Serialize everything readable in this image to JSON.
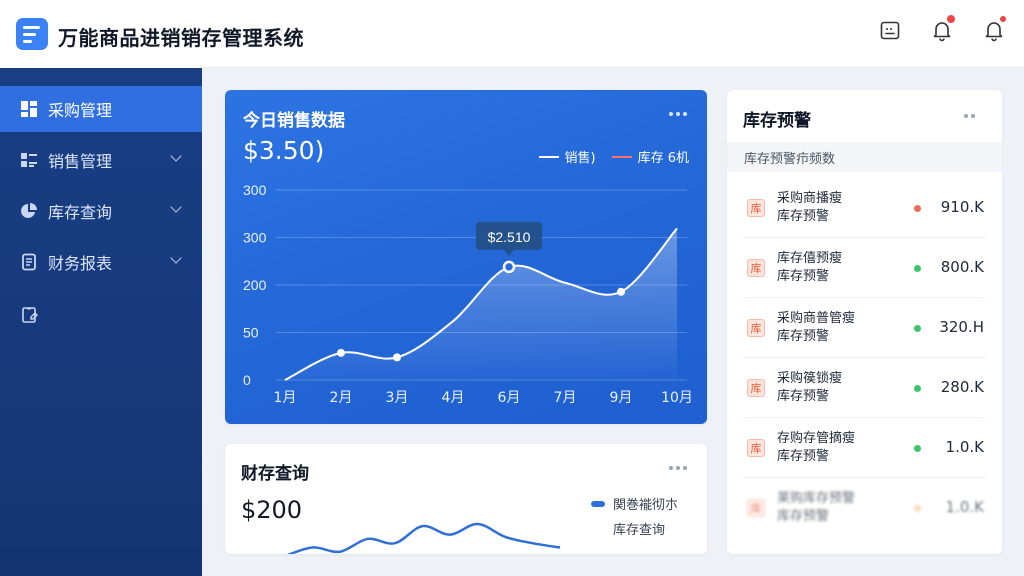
{
  "app": {
    "title": "万能商品进销销存管理系统"
  },
  "sidebar": {
    "items": [
      {
        "label": "采购管理",
        "icon": "grid-icon",
        "active": true,
        "has_children": false
      },
      {
        "label": "销售管理",
        "icon": "list-grid-icon",
        "active": false,
        "has_children": true
      },
      {
        "label": "库存查询",
        "icon": "pie-chart-icon",
        "active": false,
        "has_children": true
      },
      {
        "label": "财务报表",
        "icon": "document-icon",
        "active": false,
        "has_children": true
      }
    ],
    "extra_icon": "clipboard-icon"
  },
  "header": {
    "icons": [
      "calendar-icon",
      "notification-bell-icon",
      "bell-icon"
    ],
    "colors": {
      "notification_dot": "#ef4444"
    }
  },
  "sales_card": {
    "title": "今日销售数据",
    "amount": "$3.50)",
    "legend": [
      {
        "name": "销售)",
        "color": "#ffffff"
      },
      {
        "name": "库存 6机",
        "color": "#f87171"
      }
    ],
    "chart_data": {
      "type": "line",
      "x": [
        "1月",
        "2月",
        "3月",
        "4月",
        "6月",
        "7月",
        "9月",
        "10月"
      ],
      "y_ticks": [
        "0",
        "50",
        "200",
        "300",
        "300"
      ],
      "series": [
        {
          "name": "销售)",
          "values": [
            0,
            60,
            50,
            130,
            250,
            215,
            195,
            335
          ]
        }
      ],
      "tooltip": {
        "label": "$2.510",
        "at": "6月"
      },
      "marked_points": [
        "2月",
        "3月",
        "6月",
        "9月"
      ],
      "ylim": [
        0,
        420
      ],
      "grid": true
    }
  },
  "finance_card": {
    "title": "财存查询",
    "amount": "$200",
    "legend": [
      "関巻褦彻朩",
      "库存查询"
    ],
    "chart_data": {
      "type": "line",
      "series": [
        {
          "values": [
            10,
            18,
            14,
            26,
            22,
            38,
            30,
            40,
            28,
            22,
            18
          ]
        }
      ]
    }
  },
  "alert_card": {
    "title": "库存预警",
    "subheader": "库存预警疖频数",
    "rows": [
      {
        "name": "采购商播瘦",
        "sub": "库存预警",
        "value": "910.K",
        "status_color": "#ef6b57"
      },
      {
        "name": "库存僖预瘦",
        "sub": "库存预警",
        "value": "800.K",
        "status_color": "#3cc46b"
      },
      {
        "name": "采购商普管瘦",
        "sub": "库存预警",
        "value": "320.H",
        "status_color": "#3cc46b"
      },
      {
        "name": "采购篌锁瘦",
        "sub": "库存预警",
        "value": "280.K",
        "status_color": "#3cc46b"
      },
      {
        "name": "存购存管摘瘦",
        "sub": "库存预警",
        "value": "1.0.K",
        "status_color": "#3cc46b"
      },
      {
        "name": "莱购库存预警",
        "sub": "库存预警",
        "value": "1.0.K",
        "status_color": "#f5c99a"
      }
    ],
    "badge_char": "库"
  }
}
